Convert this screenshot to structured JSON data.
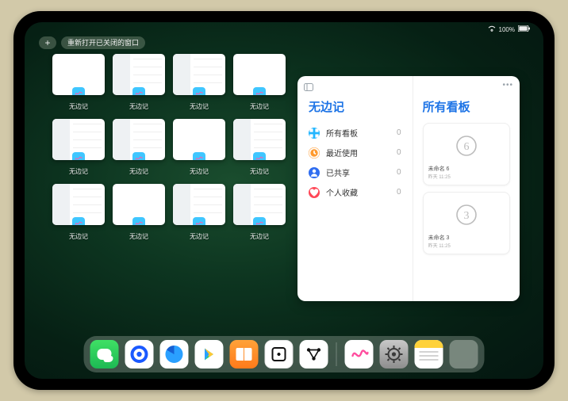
{
  "status": {
    "wifi": "wifi-icon",
    "battery_text": "100%"
  },
  "topbar": {
    "plus_label": "+",
    "reopen_label": "重新打开已关闭的窗口"
  },
  "app_name": "无边记",
  "thumbnails": [
    {
      "variant": "blank",
      "label": "无边记"
    },
    {
      "variant": "sidebar",
      "label": "无边记"
    },
    {
      "variant": "sidebar",
      "label": "无边记"
    },
    {
      "variant": "blank",
      "label": "无边记"
    },
    {
      "variant": "sidebar",
      "label": "无边记"
    },
    {
      "variant": "sidebar",
      "label": "无边记"
    },
    {
      "variant": "blank",
      "label": "无边记"
    },
    {
      "variant": "sidebar",
      "label": "无边记"
    },
    {
      "variant": "sidebar",
      "label": "无边记"
    },
    {
      "variant": "blank",
      "label": "无边记"
    },
    {
      "variant": "sidebar",
      "label": "无边记"
    },
    {
      "variant": "sidebar",
      "label": "无边记"
    }
  ],
  "preview": {
    "sidebar_title": "无边记",
    "right_title": "所有看板",
    "menu": [
      {
        "icon": "grid-icon",
        "color": "#23b6ff",
        "label": "所有看板",
        "count": 0
      },
      {
        "icon": "clock-icon",
        "color": "#ff9a2e",
        "label": "最近使用",
        "count": 0
      },
      {
        "icon": "people-icon",
        "color": "#2f6df0",
        "label": "已共享",
        "count": 0
      },
      {
        "icon": "heart-icon",
        "color": "#ff4757",
        "label": "个人收藏",
        "count": 0
      }
    ],
    "boards": [
      {
        "digit": "6",
        "title": "未命名 6",
        "subtitle": "昨天 11:25"
      },
      {
        "digit": "3",
        "title": "未命名 3",
        "subtitle": "昨天 11:25"
      }
    ]
  },
  "dock": {
    "apps": [
      {
        "name": "wechat-icon"
      },
      {
        "name": "quark-icon"
      },
      {
        "name": "qq-browser-icon"
      },
      {
        "name": "play-icon"
      },
      {
        "name": "books-icon"
      },
      {
        "name": "dice-icon"
      },
      {
        "name": "graph-icon"
      }
    ],
    "recent": [
      {
        "name": "freeform-icon"
      },
      {
        "name": "settings-icon"
      },
      {
        "name": "notes-icon"
      },
      {
        "name": "app-library-icon"
      }
    ]
  }
}
